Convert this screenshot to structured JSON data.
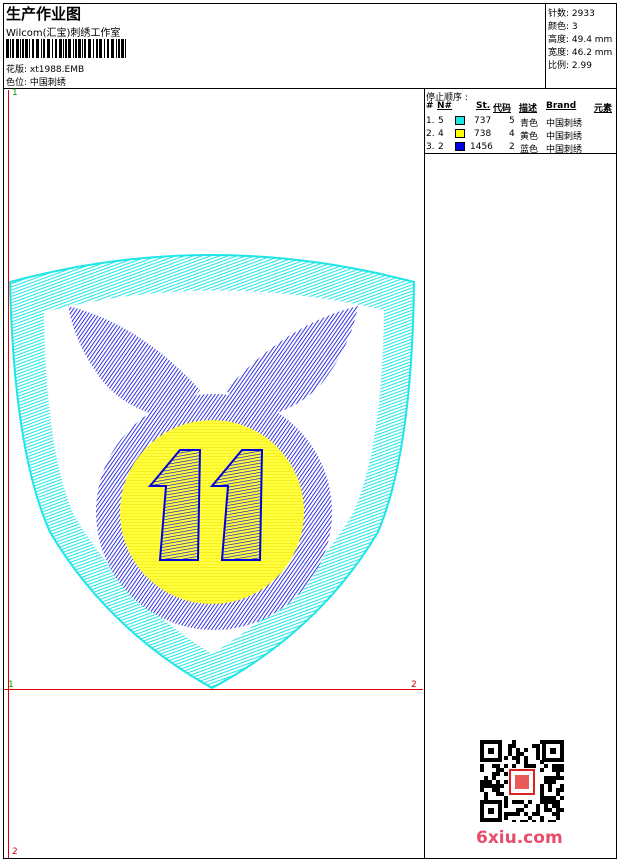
{
  "header": {
    "title": "生产作业图",
    "studio": "Wilcom(汇宝)刺绣工作室",
    "design_label": "花版: xt1988.EMB",
    "color_pos_label": "色位: 中国刺绣"
  },
  "stats": {
    "stitches": "针数: 2933",
    "colors": "颜色: 3",
    "height": "高度: 49.4 mm",
    "width": "宽度: 46.2 mm",
    "ratio": "比例: 2.99"
  },
  "stop_sequence": {
    "title": "停止顺序 :",
    "columns": [
      "#",
      "N#",
      "St.",
      "代码",
      "描述",
      "Brand",
      "元素"
    ],
    "rows": [
      {
        "idx": "1.",
        "n": "5",
        "color": "#1ee6e6",
        "st": "737",
        "code": "5",
        "desc": "青色",
        "brand": "中国刺绣"
      },
      {
        "idx": "2.",
        "n": "4",
        "color": "#ffff00",
        "st": "738",
        "code": "4",
        "desc": "黄色",
        "brand": "中国刺绣"
      },
      {
        "idx": "3.",
        "n": "2",
        "color": "#0000e0",
        "st": "1456",
        "code": "2",
        "desc": "蓝色",
        "brand": "中国刺绣"
      }
    ]
  },
  "axes": {
    "top_left": "1",
    "mid_left": "1",
    "mid_right": "2",
    "bottom_left": "2"
  },
  "design": {
    "shield_color": "#1ee6e6",
    "circle_color": "#ffff00",
    "wings_color": "#0000e0",
    "number_text": "11"
  },
  "watermark": "6xiu.com"
}
